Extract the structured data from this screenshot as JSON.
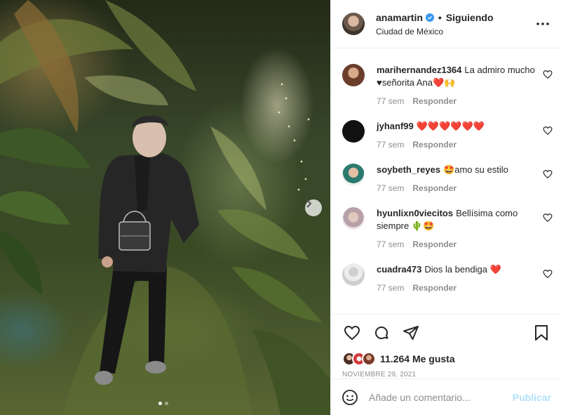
{
  "header": {
    "username": "anamartin",
    "separator": "•",
    "following": "Siguiendo",
    "location": "Ciudad de México"
  },
  "comments": [
    {
      "user": "marihernandez1364",
      "text": "La admiro mucho ♥señorita Ana❤️🙌",
      "time": "77 sem",
      "reply": "Responder"
    },
    {
      "user": "jyhanf99",
      "text": "❤️❤️❤️❤️❤️❤️",
      "time": "77 sem",
      "reply": "Responder"
    },
    {
      "user": "soybeth_reyes",
      "text": "🤩amo su estilo",
      "time": "77 sem",
      "reply": "Responder"
    },
    {
      "user": "hyunlixn0viecitos",
      "text": "Bellísima como siempre 🌵🤩",
      "time": "77 sem",
      "reply": "Responder"
    },
    {
      "user": "cuadra473",
      "text": "Dios la bendiga ❤️",
      "time": "77 sem",
      "reply": "Responder"
    }
  ],
  "likes": {
    "text": "11.264 Me gusta"
  },
  "date": "NOVIEMBRE 29, 2021",
  "add_comment": {
    "placeholder": "Añade un comentario...",
    "publish": "Publicar"
  },
  "carousel": {
    "current": 1,
    "total": 2
  },
  "colors": {
    "link": "#262626",
    "muted": "#8e8e8e",
    "publish": "#b2dffc",
    "verified": "#3897f0"
  },
  "icons": [
    "verified-icon",
    "more-icon",
    "heart-icon",
    "comment-icon",
    "share-icon",
    "save-icon",
    "emoji-icon",
    "chevron-right-icon"
  ]
}
